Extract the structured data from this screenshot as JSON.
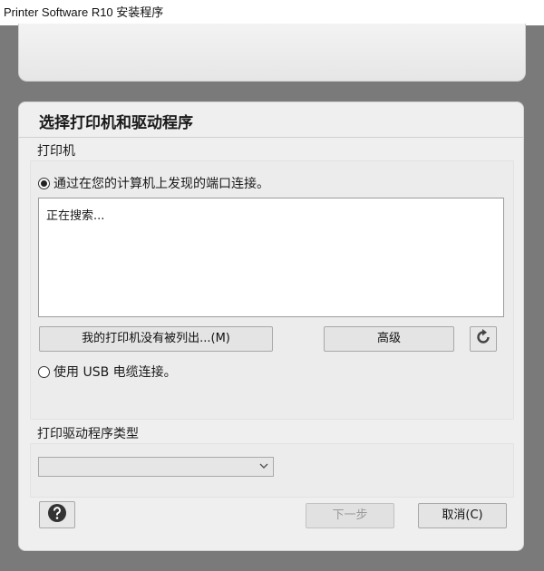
{
  "window": {
    "title": "Printer Software R10 安装程序"
  },
  "dialog": {
    "title": "选择打印机和驱动程序",
    "printer_section_label": "打印机",
    "option_network": "通过在您的计算机上发现的端口连接。",
    "list_status": "正在搜索...",
    "not_listed_button": "我的打印机没有被列出...(M)",
    "advanced_button": "高级",
    "refresh_icon": "refresh-icon",
    "option_usb": "使用 USB 电缆连接。",
    "driver_section_label": "打印驱动程序类型",
    "driver_select_value": "",
    "help_icon": "question-mark-icon",
    "next_button": "下一步",
    "cancel_button": "取消(C)"
  },
  "colors": {
    "background": "#7a7a7a",
    "dialog": "#efefef",
    "disabled_text": "#9a9a9a"
  }
}
